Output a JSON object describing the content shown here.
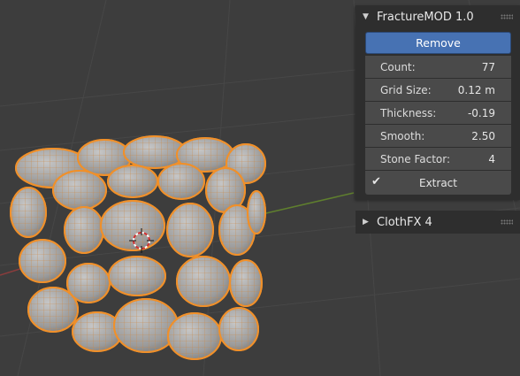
{
  "fracture_panel": {
    "title": "FractureMOD 1.0",
    "remove_label": "Remove",
    "fields": [
      {
        "label": "Count:",
        "value": "77"
      },
      {
        "label": "Grid Size:",
        "value": "0.12 m"
      },
      {
        "label": "Thickness:",
        "value": "-0.19"
      },
      {
        "label": "Smooth:",
        "value": "2.50"
      },
      {
        "label": "Stone Factor:",
        "value": "4"
      }
    ],
    "extract_label": "Extract",
    "extract_checked": true
  },
  "clothfx_panel": {
    "title": "ClothFX 4"
  },
  "colors": {
    "viewport_bg": "#3d3d3d",
    "grid": "#474747",
    "x_axis": "#8a3c3c",
    "y_axis": "#5f7f2e",
    "selection_outline": "#f0902a",
    "stone_fill": "#9a9a9a",
    "accent_button": "#4772b3",
    "panel_bg": "#2e2e2e",
    "field_bg": "#4a4a4a"
  },
  "icons": [
    "collapse-triangle-icon",
    "expand-triangle-icon",
    "drag-grip-icon",
    "checkmark-icon",
    "3d-cursor-icon"
  ]
}
